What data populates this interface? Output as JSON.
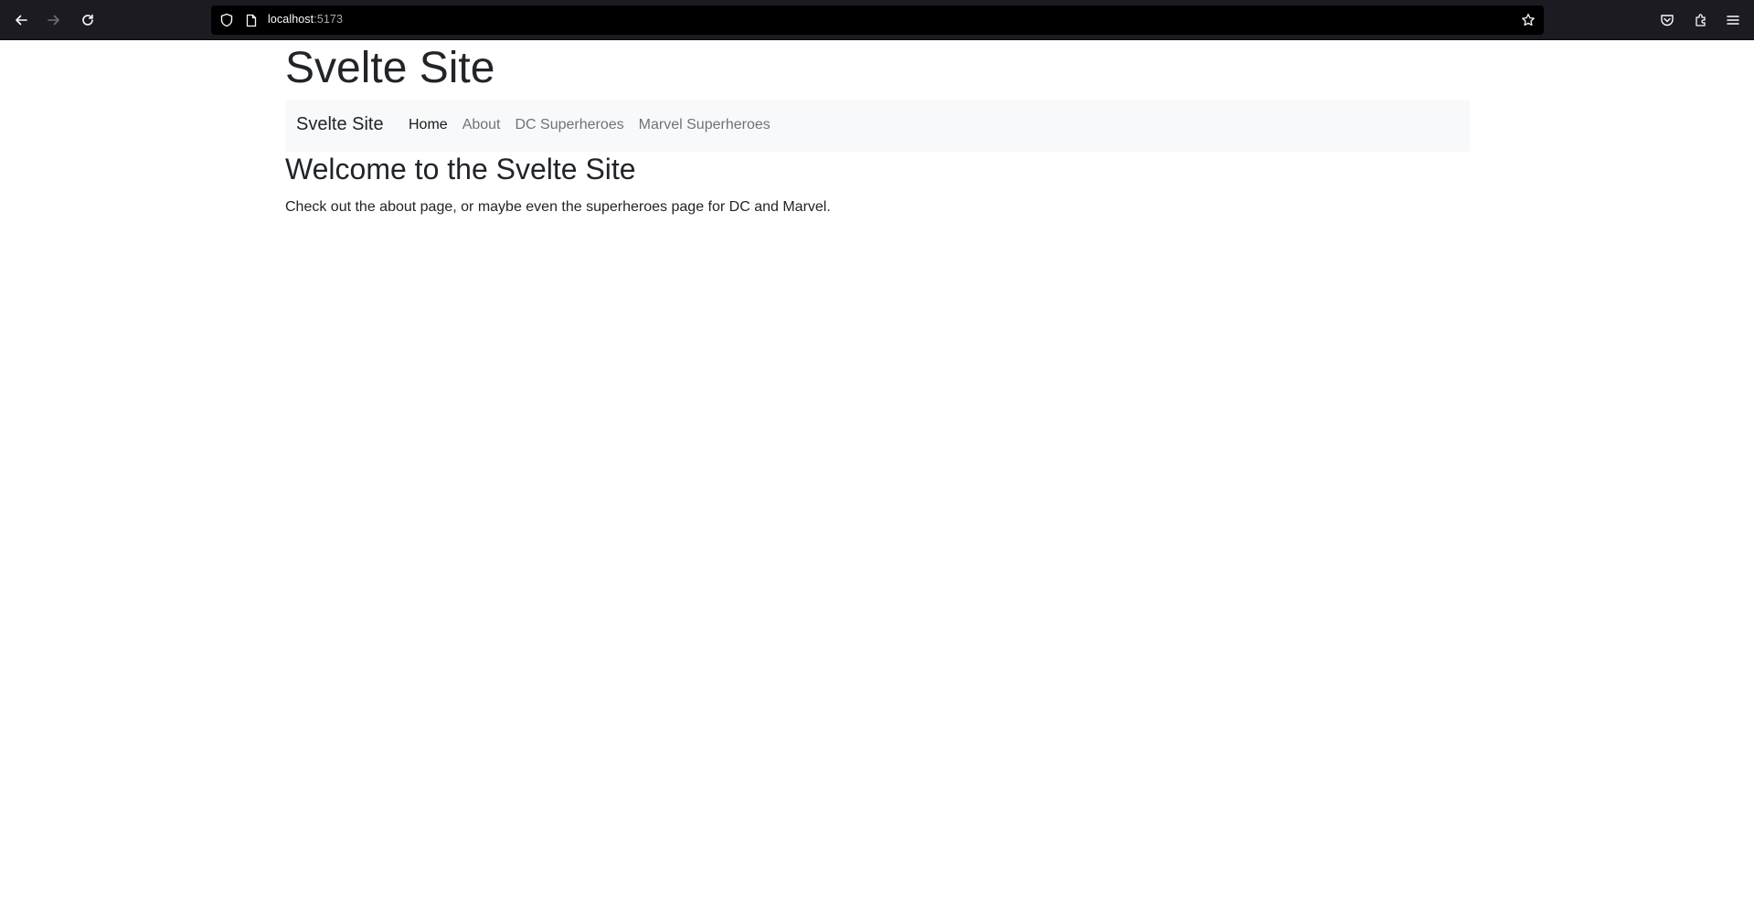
{
  "browser": {
    "url_host": "localhost",
    "url_port": ":5173",
    "icons": {
      "back": "arrow-left-icon",
      "forward": "arrow-right-icon",
      "reload": "reload-icon",
      "tracking": "shield-icon",
      "page": "page-icon",
      "bookmark": "star-icon",
      "pocket": "pocket-icon",
      "extensions": "puzzle-icon",
      "menu": "hamburger-menu-icon"
    }
  },
  "site": {
    "title": "Svelte Site",
    "nav": {
      "brand": "Svelte Site",
      "links": [
        {
          "label": "Home",
          "active": true
        },
        {
          "label": "About",
          "active": false
        },
        {
          "label": "DC Superheroes",
          "active": false
        },
        {
          "label": "Marvel Superheroes",
          "active": false
        }
      ]
    },
    "heading": "Welcome to the Svelte Site",
    "intro": "Check out the about page, or maybe even the superheroes page for DC and Marvel."
  },
  "colors": {
    "toolbar_bg": "#1c1b22",
    "urlbar_bg": "#000000",
    "navbar_bg": "#f8f9fa",
    "text": "#212529"
  }
}
